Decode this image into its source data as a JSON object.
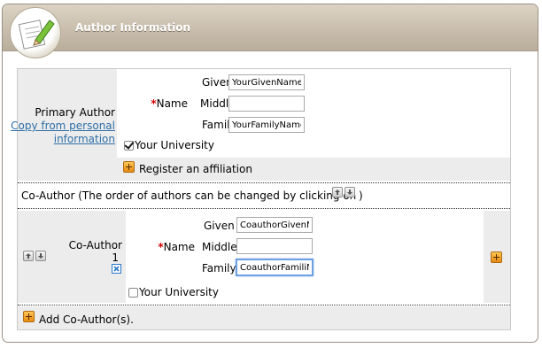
{
  "header": {
    "title": "Author Information"
  },
  "primary_author": {
    "label": "Primary Author",
    "copy_link_line1": "Copy from personal",
    "copy_link_line2": "information",
    "name_required_mark": "*",
    "name_label": "Name",
    "given_label": "Given",
    "middle_label": "Middle",
    "family_label": "Family",
    "given_value": "YourGivenName",
    "middle_value": "",
    "family_value": "YourFamilyName",
    "university_label": "Your University",
    "university_checked": true,
    "register_affiliation_label": "Register an affiliation"
  },
  "coauthor_note": {
    "text_prefix": "Co-Author (The order of authors can be changed by clicking on",
    "text_suffix": ")"
  },
  "coauthor": {
    "label": "Co-Author",
    "number": "1",
    "name_required_mark": "*",
    "name_label": "Name",
    "given_label": "Given",
    "middle_label": "Middle",
    "family_label": "Family",
    "given_value": "CoauthorGivenNa",
    "middle_value": "",
    "family_value": "CoauthorFamiliNa",
    "university_label": "Your University",
    "university_checked": false
  },
  "add_coauthor_label": "Add Co-Author(s).",
  "colors": {
    "accent_orange": "#e58a12",
    "link_blue": "#2f6fa7",
    "required_red": "#d40000",
    "header_tan": "#b9ad9b"
  }
}
